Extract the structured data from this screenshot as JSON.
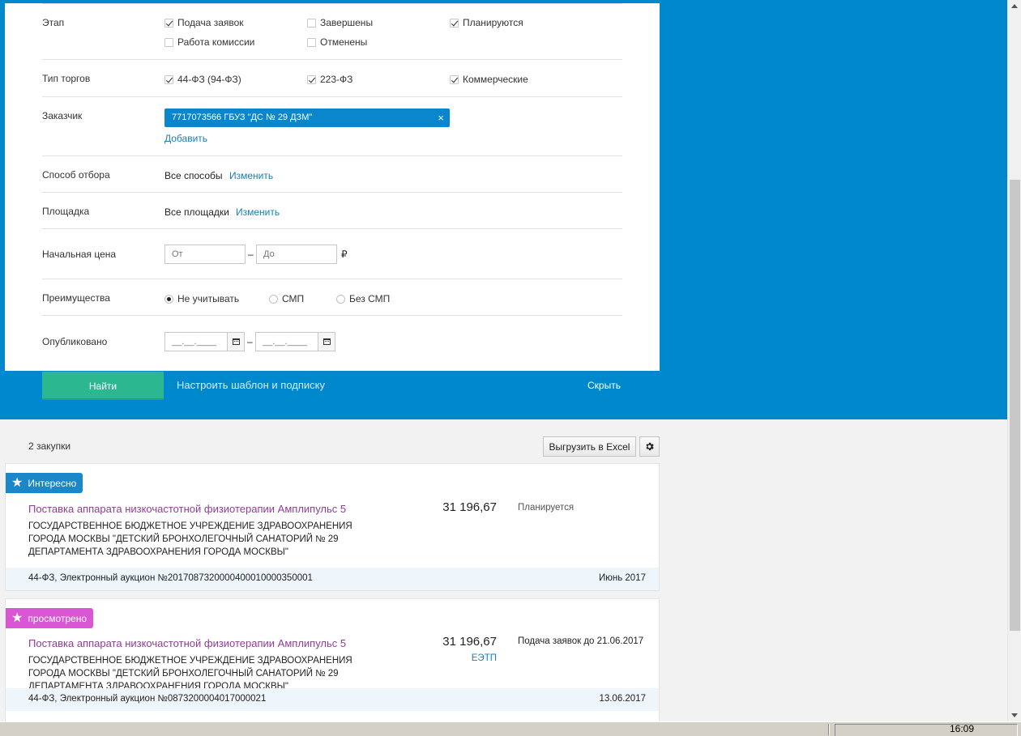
{
  "filters": {
    "stage": {
      "label": "Этап",
      "options": [
        {
          "label": "Подача заявок",
          "checked": true
        },
        {
          "label": "Завершены",
          "checked": false
        },
        {
          "label": "Планируются",
          "checked": true
        },
        {
          "label": "Работа комиссии",
          "checked": false
        },
        {
          "label": "Отменены",
          "checked": false
        }
      ]
    },
    "tender_type": {
      "label": "Тип торгов",
      "options": [
        {
          "label": "44-ФЗ (94-ФЗ)",
          "checked": true
        },
        {
          "label": "223-ФЗ",
          "checked": true
        },
        {
          "label": "Коммерческие",
          "checked": true
        }
      ]
    },
    "customer": {
      "label": "Заказчик",
      "chip": "7717073566  ГБУЗ \"ДС № 29 ДЗМ\"",
      "chip_close": "×",
      "add_label": "Добавить"
    },
    "selection_method": {
      "label": "Способ отбора",
      "value": "Все способы",
      "change_label": "Изменить"
    },
    "platform": {
      "label": "Площадка",
      "value": "Все площадки",
      "change_label": "Изменить"
    },
    "start_price": {
      "label": "Начальная цена",
      "from_placeholder": "От",
      "to_placeholder": "До",
      "dash": "–",
      "currency": "₽"
    },
    "advantages": {
      "label": "Преимущества",
      "options": [
        {
          "label": "Не учитывать",
          "selected": true
        },
        {
          "label": "СМП",
          "selected": false
        },
        {
          "label": "Без СМП",
          "selected": false
        }
      ]
    },
    "published": {
      "label": "Опубликовано",
      "from_placeholder": "__.__.____",
      "to_placeholder": "__.__.____",
      "dash": "–"
    }
  },
  "actions": {
    "find_label": "Найти",
    "template_label": "Настроить шаблон и подписку",
    "hide_label": "Скрыть"
  },
  "results": {
    "count_label": "2 закупки",
    "excel_label": "Выгрузить в Excel",
    "items": [
      {
        "tag": "Интересно",
        "tag_color": "#1b87c9",
        "title": "Поставка аппарата низкочастотной физиотерапии Амплипульс 5",
        "org": "ГОСУДАРСТВЕННОЕ БЮДЖЕТНОЕ УЧРЕЖДЕНИЕ ЗДРАВООХРАНЕНИЯ ГОРОДА МОСКВЫ \"ДЕТСКИЙ БРОНХОЛЕГОЧНЫЙ САНАТОРИЙ № 29 ДЕПАРТАМЕНТА ЗДРАВООХРАНЕНИЯ ГОРОДА МОСКВЫ\"",
        "price": "31 196,67",
        "platform": "",
        "status": "Планируется",
        "footer_left": "44-ФЗ, Электронный аукцион №2017087320000400010000350001",
        "footer_right": "Июнь 2017"
      },
      {
        "tag": "просмотрено",
        "tag_color": "#d957d2",
        "title": "Поставка аппарата низкочастотной физиотерапии Амплипульс 5",
        "org": "ГОСУДАРСТВЕННОЕ БЮДЖЕТНОЕ УЧРЕЖДЕНИЕ ЗДРАВООХРАНЕНИЯ ГОРОДА МОСКВЫ \"ДЕТСКИЙ БРОНХОЛЕГОЧНЫЙ САНАТОРИЙ № 29 ДЕПАРТАМЕНТА ЗДРАВООХРАНЕНИЯ ГОРОДА МОСКВЫ\"",
        "price": "31 196,67",
        "platform": "ЕЭТП",
        "status": "Подача заявок до 21.06.2017",
        "footer_left": "44-ФЗ, Электронный аукцион №0873200004017000021",
        "footer_right": "13.06.2017"
      }
    ]
  },
  "taskbar": {
    "time": "16:09"
  },
  "colors": {
    "band": "#0088cc",
    "find_button": "#2bb891",
    "link": "#1a7fb5",
    "title": "#8e3e94"
  }
}
